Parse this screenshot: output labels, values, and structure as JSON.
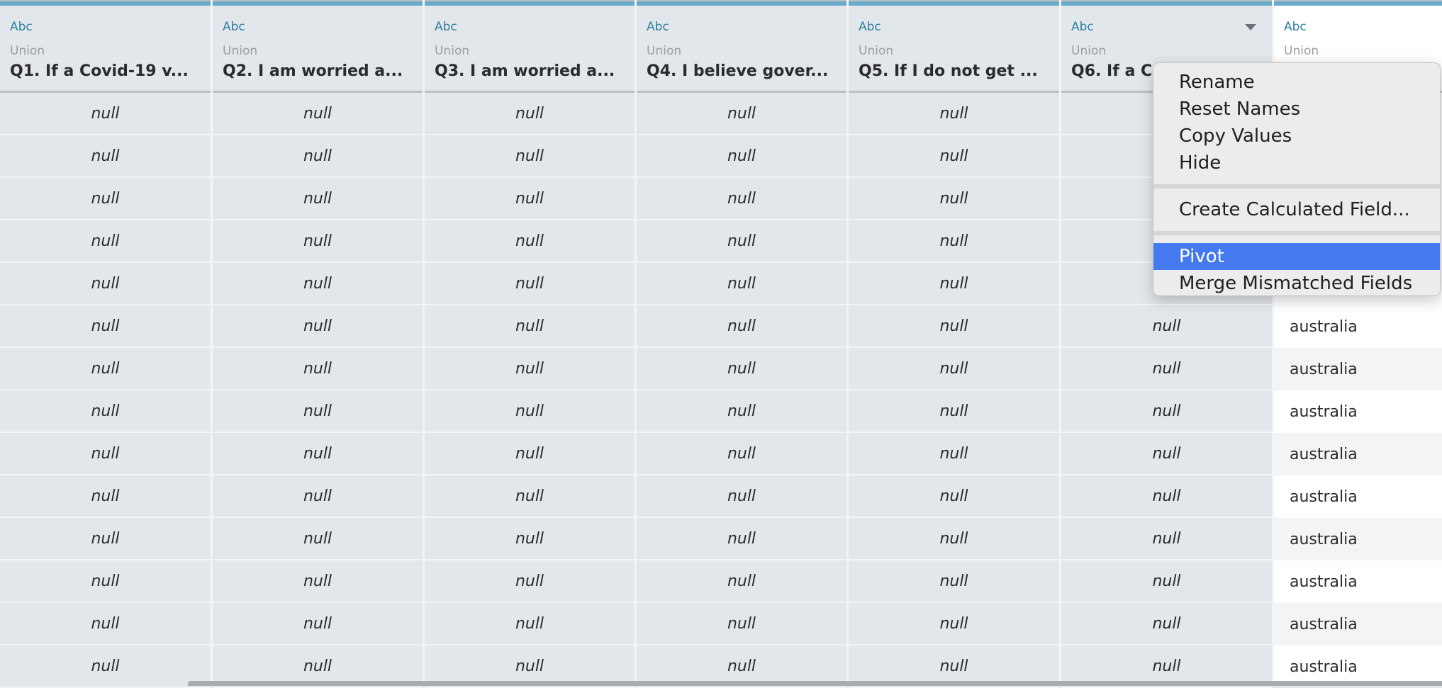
{
  "columns": [
    {
      "type": "Abc",
      "origin": "Union",
      "name": "Q1. If a Covid-19 v..."
    },
    {
      "type": "Abc",
      "origin": "Union",
      "name": "Q2. I am worried a..."
    },
    {
      "type": "Abc",
      "origin": "Union",
      "name": "Q3. I am worried a..."
    },
    {
      "type": "Abc",
      "origin": "Union",
      "name": "Q4. I believe gover..."
    },
    {
      "type": "Abc",
      "origin": "Union",
      "name": "Q5. If I do not get ..."
    },
    {
      "type": "Abc",
      "origin": "Union",
      "name": "Q6. If a Co"
    },
    {
      "type": "Abc",
      "origin": "Union",
      "name": ""
    }
  ],
  "null_value": "null",
  "last_col_value": "australia",
  "menu": {
    "items": [
      "Rename",
      "Reset Names",
      "Copy Values",
      "Hide",
      "Create Calculated Field...",
      "Pivot",
      "Merge Mismatched Fields"
    ],
    "selected": "Pivot"
  },
  "colors": {
    "accent": "#6aaacb",
    "selection": "#4479ef"
  }
}
